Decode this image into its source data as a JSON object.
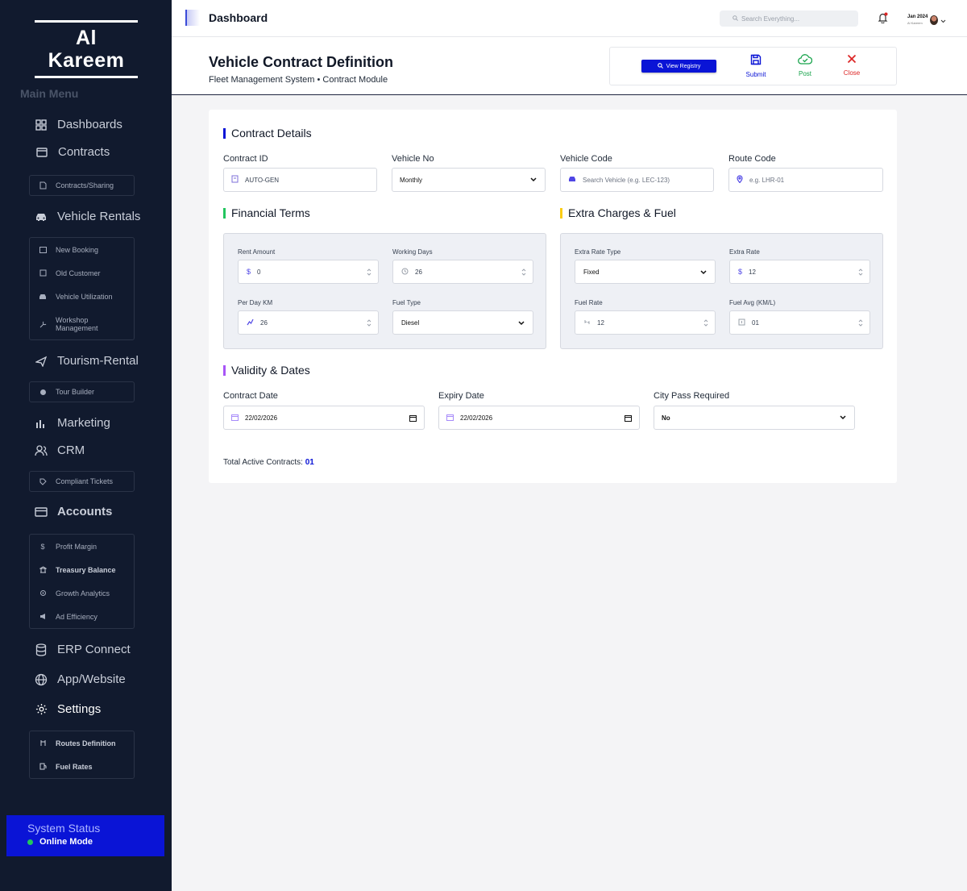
{
  "brand": "Al Kareem",
  "sidebar": {
    "menu_title": "Main Menu",
    "items": {
      "dashboards": "Dashboards",
      "contracts": "Contracts",
      "contracts_sharing": "Contracts/Sharing",
      "vehicle_rentals": "Vehicle Rentals",
      "new_booking": "New Booking",
      "old_customer": "Old Customer",
      "vehicle_utilization": "Vehicle Utilization",
      "workshop_management": "Workshop Management",
      "tourism_rental": "Tourism-Rental",
      "tour_builder": "Tour Builder",
      "marketing": "Marketing",
      "crm": "CRM",
      "compliant_tickets": "Compliant Tickets",
      "accounts": "Accounts",
      "profit_margin": "Profit Margin",
      "treasury_balance": "Treasury Balance",
      "growth_analytics": "Growth Analytics",
      "ad_efficiency": "Ad Efficiency",
      "erp_connect": "ERP Connect",
      "app_website": "App/Website",
      "settings": "Settings",
      "routes_definition": "Routes Definition",
      "fuel_rates": "Fuel Rates"
    },
    "status": {
      "title": "System Status",
      "mode": "Online Mode"
    }
  },
  "topbar": {
    "title": "Dashboard",
    "search_placeholder": "Search Everything...",
    "user_date": "Jan 2024",
    "user_name": "Al Kareem"
  },
  "page": {
    "title": "Vehicle Contract Definition",
    "subtitle": "Fleet Management System • Contract Module",
    "actions": {
      "view_registry": "View Registry",
      "submit": "Submit",
      "post": "Post",
      "close": "Close"
    }
  },
  "contract_details": {
    "title": "Contract Details",
    "contract_id_label": "Contract ID",
    "contract_id_value": "AUTO-GEN",
    "vehicle_no_label": "Vehicle No",
    "vehicle_no_value": "Monthly",
    "vehicle_code_label": "Vehicle Code",
    "vehicle_code_placeholder": "Search Vehicle (e.g. LEC-123)",
    "route_code_label": "Route Code",
    "route_code_placeholder": "e.g. LHR-01"
  },
  "financial": {
    "title": "Financial Terms",
    "rent_amount_label": "Rent Amount",
    "rent_amount_value": "0",
    "working_days_label": "Working Days",
    "working_days_value": "26",
    "per_day_km_label": "Per Day KM",
    "per_day_km_value": "26",
    "fuel_type_label": "Fuel Type",
    "fuel_type_value": "Diesel"
  },
  "extra": {
    "title": "Extra Charges & Fuel",
    "extra_rate_type_label": "Extra Rate Type",
    "extra_rate_type_value": "Fixed",
    "extra_rate_label": "Extra Rate",
    "extra_rate_value": "12",
    "fuel_rate_label": "Fuel Rate",
    "fuel_rate_value": "12",
    "fuel_avg_label": "Fuel Avg (KM/L)",
    "fuel_avg_value": "01"
  },
  "validity": {
    "title": "Validity & Dates",
    "contract_date_label": "Contract Date",
    "contract_date_value": "22/02/2026",
    "expiry_date_label": "Expiry Date",
    "expiry_date_value": "22/02/2026",
    "city_pass_label": "City Pass Required",
    "city_pass_value": "No"
  },
  "footer": {
    "total_label": "Total Active Contracts:",
    "total_value": "01"
  },
  "colors": {
    "sidebar_bg": "#111a2e",
    "primary": "#0a14d6",
    "contract_bar": "#0a14d6",
    "financial_bar": "#22c55e",
    "extra_bar": "#facc15",
    "validity_bar": "#a855f7",
    "post_green": "#16a34a",
    "close_red": "#dc2626"
  },
  "icons": {
    "dashboards": "grid-icon",
    "contracts": "card-icon",
    "vehicle": "car-icon",
    "tourism": "plane-icon",
    "marketing": "bar-chart-icon",
    "crm": "users-icon",
    "erp": "database-icon",
    "app": "globe-icon",
    "settings": "gear-icon"
  }
}
